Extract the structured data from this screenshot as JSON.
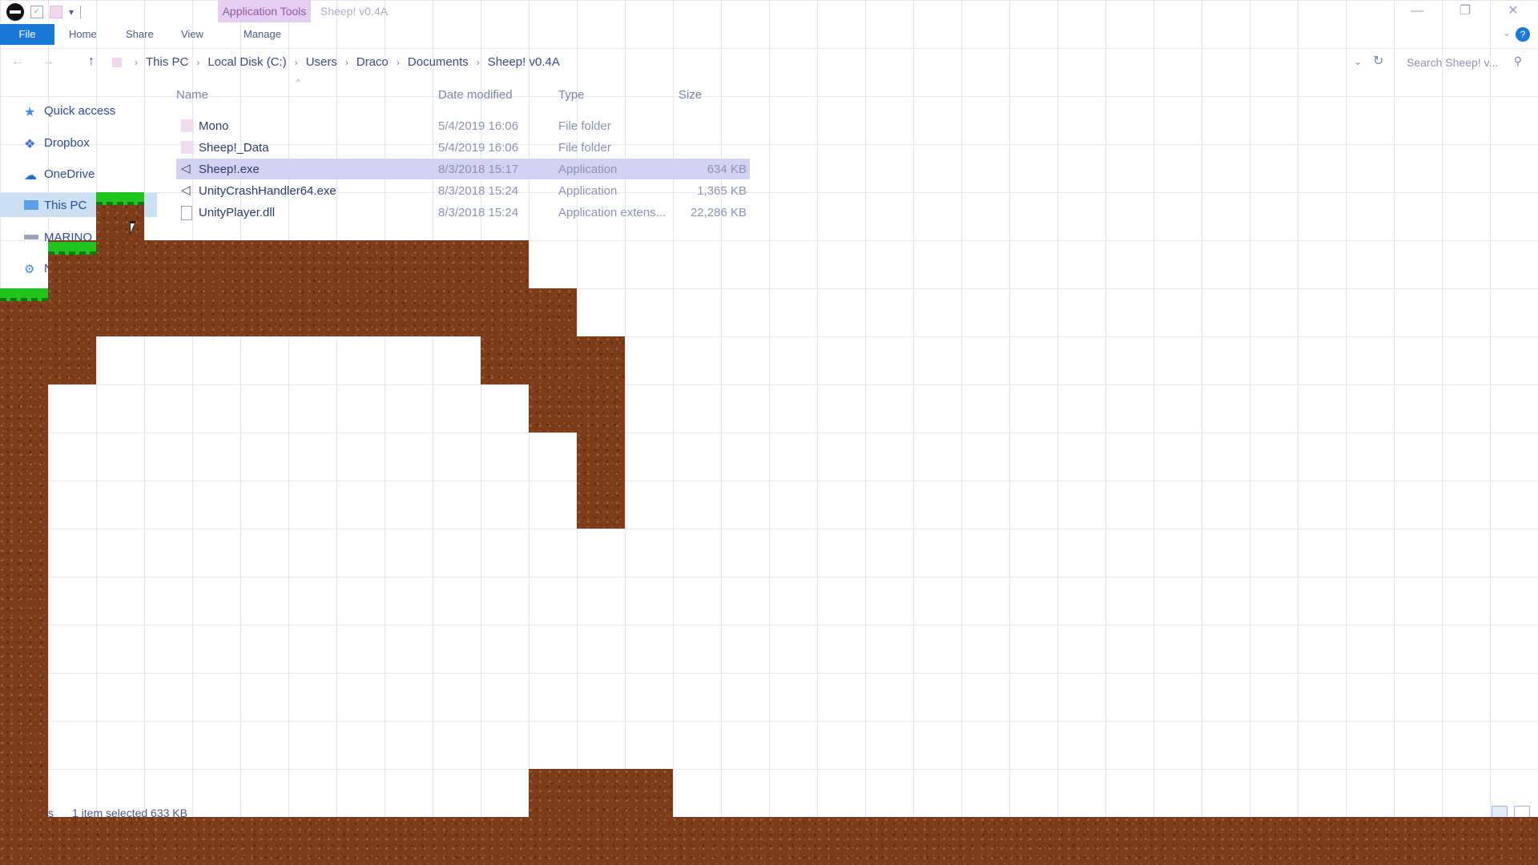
{
  "window": {
    "title": "Sheep! v0.4A",
    "context_tab": "Application Tools",
    "controls": {
      "minimize": "—",
      "maximize": "❐",
      "close": "✕"
    }
  },
  "quick_access_toolbar": {
    "check": "✓",
    "dropdown": "▾"
  },
  "ribbon": {
    "tabs": [
      "File",
      "Home",
      "Share",
      "View",
      "Manage"
    ],
    "help": "?",
    "collapse": "⌄"
  },
  "address": {
    "back": "←",
    "forward": "→",
    "up": "↑",
    "breadcrumbs": [
      "This PC",
      "Local Disk (C:)",
      "Users",
      "Draco",
      "Documents",
      "Sheep! v0.4A"
    ],
    "separator": "›",
    "dropdown": "⌄",
    "refresh": "↻"
  },
  "search": {
    "placeholder": "Search Sheep! v...",
    "icon": "search-icon"
  },
  "nav_pane": {
    "items": [
      {
        "label": "Quick access",
        "icon": "star-icon"
      },
      {
        "label": "Dropbox",
        "icon": "dropbox-icon"
      },
      {
        "label": "OneDrive",
        "icon": "cloud-icon"
      },
      {
        "label": "This PC",
        "icon": "computer-icon",
        "selected": true
      },
      {
        "label": "MARINO",
        "icon": "drive-icon"
      },
      {
        "label": "N",
        "icon": "network-icon"
      }
    ]
  },
  "columns": {
    "name": "Name",
    "date": "Date modified",
    "type": "Type",
    "size": "Size",
    "sort_indicator": "^"
  },
  "files": [
    {
      "name": "Mono",
      "date": "5/4/2019 16:06",
      "type": "File folder",
      "size": "",
      "icon": "folder-icon"
    },
    {
      "name": "Sheep!_Data",
      "date": "5/4/2019 16:06",
      "type": "File folder",
      "size": "",
      "icon": "folder-icon"
    },
    {
      "name": "Sheep!.exe",
      "date": "8/3/2018 15:17",
      "type": "Application",
      "size": "634 KB",
      "icon": "unity-app-icon",
      "selected": true
    },
    {
      "name": "UnityCrashHandler64.exe",
      "date": "8/3/2018 15:24",
      "type": "Application",
      "size": "1,365 KB",
      "icon": "unity-app-icon"
    },
    {
      "name": "UnityPlayer.dll",
      "date": "8/3/2018 15:24",
      "type": "Application extens...",
      "size": "22,286 KB",
      "icon": "dll-file-icon"
    }
  ],
  "status": {
    "items_partial": "s",
    "selection": "1 item selected  633 KB"
  },
  "colors": {
    "accent": "#1979d6",
    "selection": "#d4d2f2",
    "context_tab": "#e6cef2",
    "dirt": "#7d3d1a",
    "grass": "#1fc41f"
  }
}
